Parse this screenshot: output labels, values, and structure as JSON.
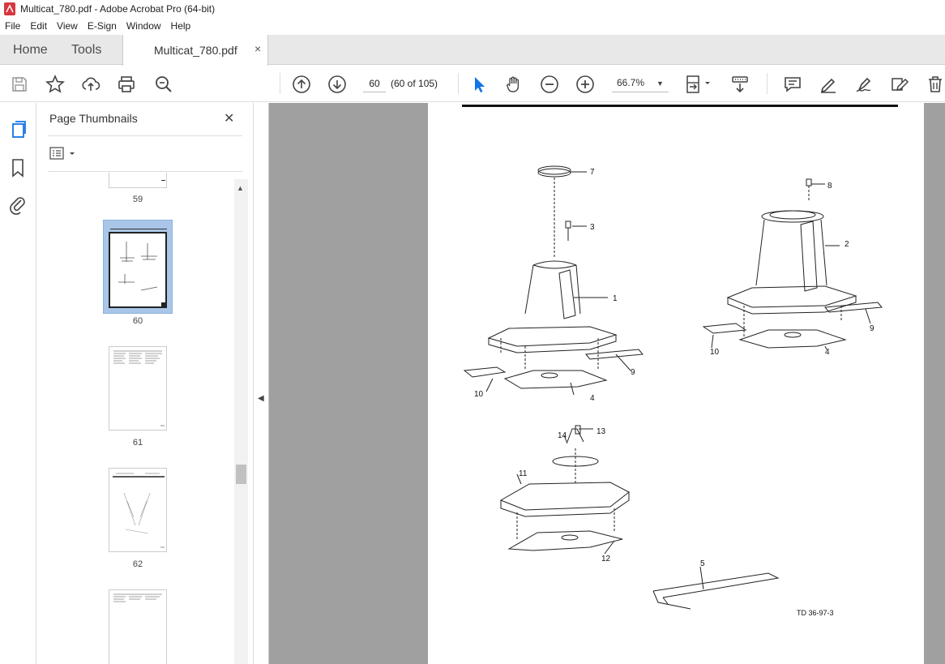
{
  "window": {
    "title": "Multicat_780.pdf - Adobe Acrobat Pro (64-bit)"
  },
  "menu": [
    "File",
    "Edit",
    "View",
    "E-Sign",
    "Window",
    "Help"
  ],
  "tabs": {
    "home": "Home",
    "tools": "Tools",
    "document": "Multicat_780.pdf",
    "close": "×"
  },
  "toolbar": {
    "page_value": "60",
    "page_count": "(60 of 105)",
    "zoom": "66.7%"
  },
  "panel": {
    "title": "Page Thumbnails",
    "close": "✕",
    "thumbnails": [
      {
        "label": "59",
        "selected": false
      },
      {
        "label": "60",
        "selected": true
      },
      {
        "label": "61",
        "selected": false
      },
      {
        "label": "62",
        "selected": false
      },
      {
        "label": "",
        "selected": false
      }
    ]
  },
  "document": {
    "callouts": [
      "7",
      "3",
      "1",
      "8",
      "2",
      "9",
      "10",
      "4",
      "9",
      "10",
      "4",
      "14",
      "13",
      "11",
      "12",
      "5"
    ],
    "figure_code": "TD 36-97-3"
  },
  "colors": {
    "accent": "#1473e6",
    "canvas": "#a0a0a0",
    "selected_thumb": "#a9c6e8"
  }
}
